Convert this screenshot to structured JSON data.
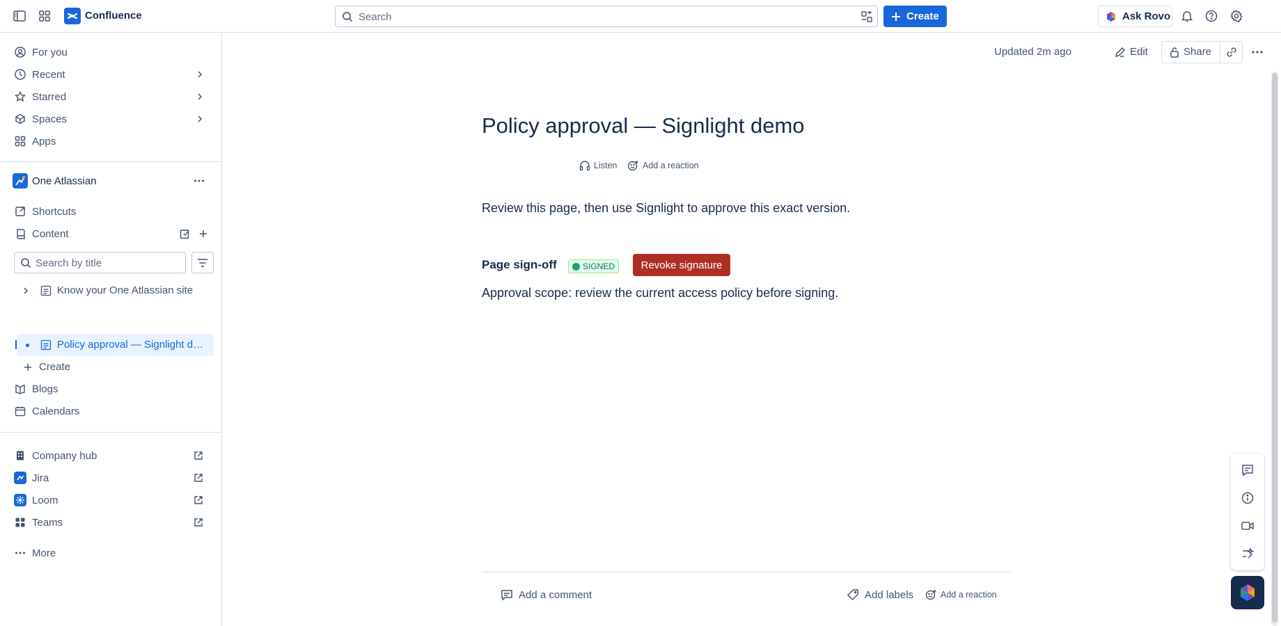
{
  "topbar": {
    "app_name": "Confluence",
    "search_placeholder": "Search",
    "create_label": "Create",
    "ask_rovo_label": "Ask Rovo"
  },
  "sidebar": {
    "nav": [
      {
        "label": "For you",
        "icon": "user-circle-icon"
      },
      {
        "label": "Recent",
        "icon": "clock-icon"
      },
      {
        "label": "Starred",
        "icon": "star-icon"
      },
      {
        "label": "Spaces",
        "icon": "spaces-icon"
      },
      {
        "label": "Apps",
        "icon": "apps-icon"
      }
    ],
    "space_name": "One Atlassian",
    "space_items": [
      {
        "label": "Shortcuts",
        "icon": "link-icon"
      },
      {
        "label": "Content",
        "icon": "content-icon"
      }
    ],
    "title_search_placeholder": "Search by title",
    "tree": [
      {
        "label": "Know your One Atlassian site",
        "selected": false
      },
      {
        "label": "Policy approval — Signlight demo",
        "selected": true
      }
    ],
    "tree_create": "Create",
    "more_items": [
      {
        "label": "Blogs",
        "icon": "blog-icon"
      },
      {
        "label": "Calendars",
        "icon": "calendar-icon"
      }
    ],
    "apps": [
      {
        "label": "Company hub",
        "icon": "company-hub-icon"
      },
      {
        "label": "Jira",
        "icon": "jira-icon"
      },
      {
        "label": "Loom",
        "icon": "loom-icon"
      },
      {
        "label": "Teams",
        "icon": "teams-icon"
      }
    ],
    "more_label": "More"
  },
  "page": {
    "updated": "Updated 2m ago",
    "edit_label": "Edit",
    "share_label": "Share",
    "title": "Policy approval — Signlight demo",
    "listen_label": "Listen",
    "add_reaction_label": "Add a reaction",
    "body_text": "Review this page, then use Signlight to approve this exact version.",
    "signoff_label": "Page sign-off",
    "signed_badge": "SIGNED",
    "revoke_label": "Revoke signature",
    "scope_text": "Approval scope: review the current access policy before signing.",
    "add_comment_label": "Add a comment",
    "add_labels_label": "Add labels",
    "footer_reaction_label": "Add a reaction"
  },
  "colors": {
    "brand_blue": "#1868db",
    "selected_bg": "#e9f2ff",
    "revoke_red": "#ae2e24",
    "signed_green": "#22a06b"
  }
}
